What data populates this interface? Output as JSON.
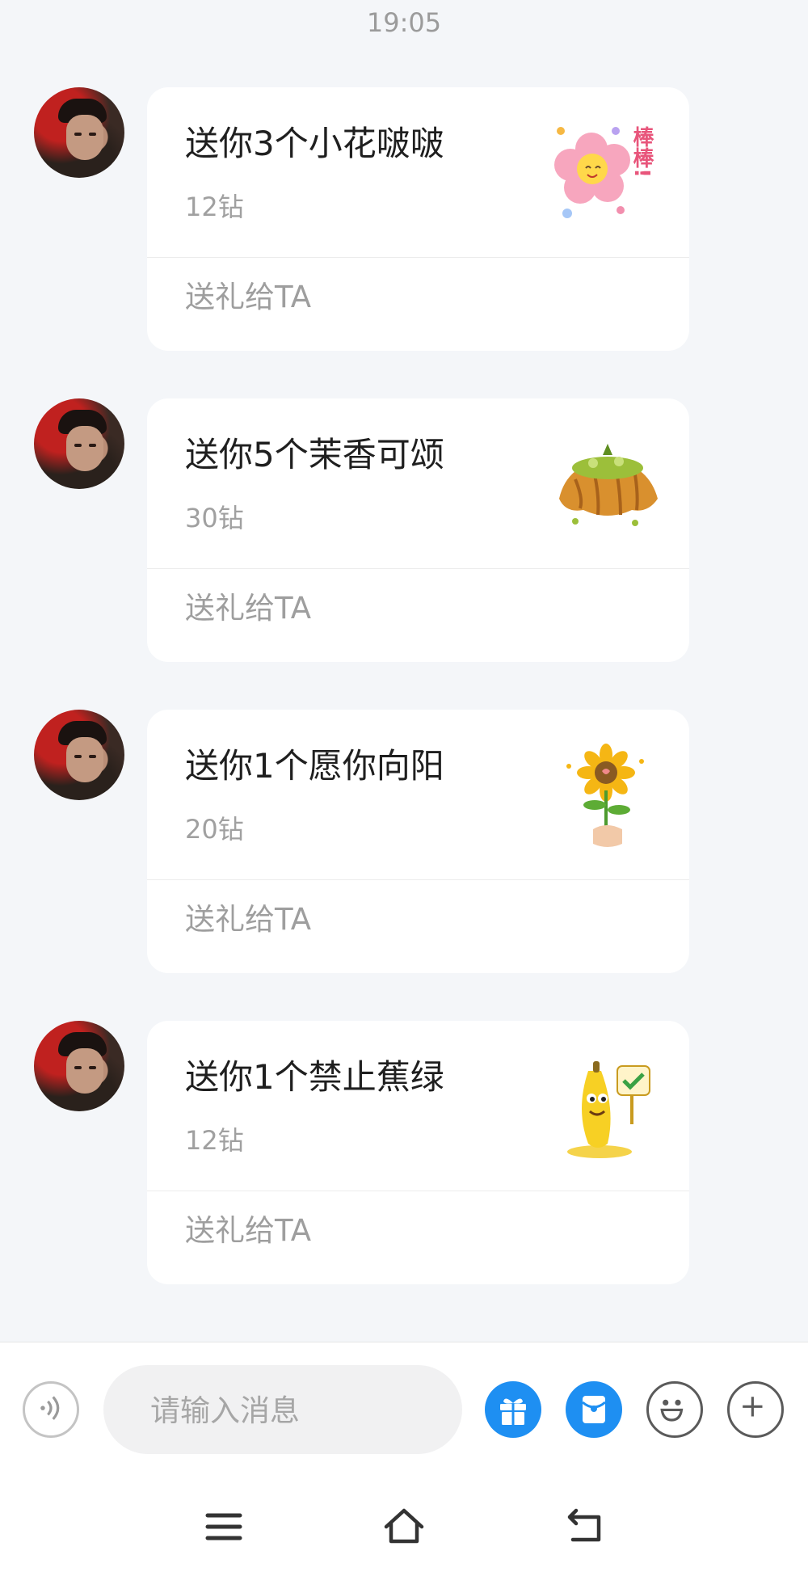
{
  "timestamp": "19:05",
  "messages": [
    {
      "title": "送你3个小花啵啵",
      "price": "12钻",
      "action": "送礼给TA",
      "gift_icon": "pink-flower-sticker-icon",
      "sticker_text": "棒棒!"
    },
    {
      "title": "送你5个茉香可颂",
      "price": "30钻",
      "action": "送礼给TA",
      "gift_icon": "croissant-sticker-icon"
    },
    {
      "title": "送你1个愿你向阳",
      "price": "20钻",
      "action": "送礼给TA",
      "gift_icon": "sunflower-sticker-icon"
    },
    {
      "title": "送你1个禁止蕉绿",
      "price": "12钻",
      "action": "送礼给TA",
      "gift_icon": "banana-sticker-icon"
    }
  ],
  "composer": {
    "placeholder": "请输入消息",
    "value": ""
  },
  "colors": {
    "accent_blue": "#1e8ff2",
    "background": "#f4f6f9",
    "card": "#ffffff",
    "muted_text": "#9e9e9e"
  }
}
